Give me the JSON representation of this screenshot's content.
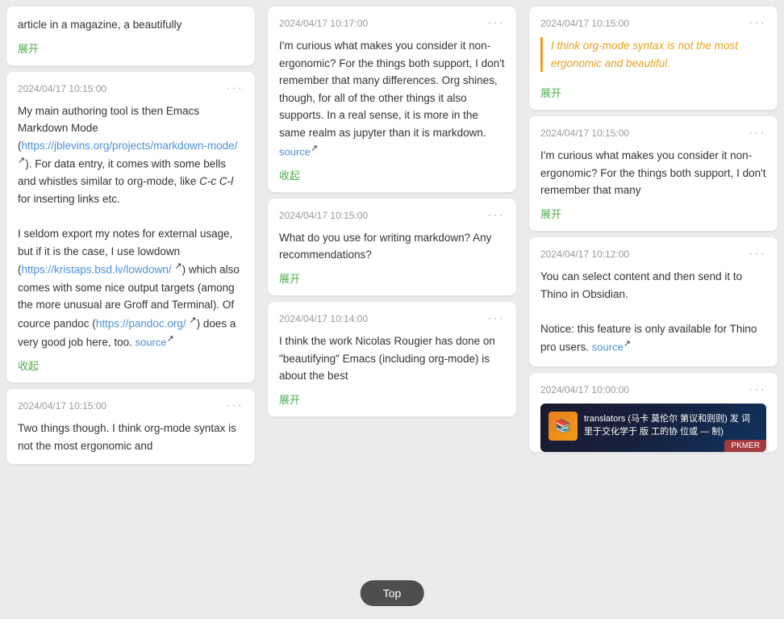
{
  "colors": {
    "accent_green": "#4caf50",
    "accent_blue": "#4a90d9",
    "accent_orange": "#e67e22",
    "text_muted": "#999",
    "bg_card": "#ffffff",
    "bg_page": "#e8e8e8"
  },
  "top_button": "Top",
  "columns": [
    {
      "id": "left",
      "cards": [
        {
          "id": "left-1",
          "timestamp": "",
          "has_timestamp": false,
          "truncated_top": true,
          "body_html": "article in a magazine, a beautifully",
          "action": "展开",
          "action_type": "expand"
        },
        {
          "id": "left-2",
          "timestamp": "2024/04/17 10:15:00",
          "body_parts": [
            "My main authoring tool is then Emacs Markdown Mode (",
            "https://jblevins.org/projects/markdown-mode/",
            "https://jblevins.org/projects/markdown-mode/",
            "). For data entry, it comes with some bells and whistles similar to org-mode, like ",
            "C-c C-l",
            " for inserting links etc."
          ],
          "body_text": "My main authoring tool is then Emacs Markdown Mode (https://jblevins.org/projects/markdown-mode/). For data entry, it comes with some bells and whistles similar to org-mode, like C-c C-l for inserting links etc.",
          "link1_text": "https://jblevins.org/projects/markdown-mode/",
          "link1_url": "https://jblevins.org/projects/markdown-mode/",
          "paragraph2": "I seldom export my notes for external usage, but if it is the case, I use lowdown (https://kristaps.bsd.lv/lowdown/) which also comes with some nice output targets (among the more unusual are Groff and Terminal). Of cource pandoc (https://pandoc.org/) does a very good job here, too.",
          "link2_text": "https://kristaps.bsd.lv/lowdown/",
          "link3_text": "https://pandoc.org/",
          "source_text": "source",
          "action": "收起",
          "action_type": "collapse"
        },
        {
          "id": "left-3",
          "timestamp": "2024/04/17 10:15:00",
          "body_text": "Two things though. I think org-mode syntax is not the most ergonomic and",
          "action": null
        }
      ]
    },
    {
      "id": "middle",
      "cards": [
        {
          "id": "mid-1",
          "timestamp": "2024/04/17 10:17:00",
          "body_text": "I'm curious what makes you consider it non-ergonomic? For the things both support, I don't remember that many differences. Org shines, though, for all of the other things it also supports. In a real sense, it is more in the same realm as jupyter than it is markdown.",
          "source_text": "source",
          "action": "收起",
          "action_type": "collapse"
        },
        {
          "id": "mid-2",
          "timestamp": "2024/04/17 10:15:00",
          "body_text": "What do you use for writing markdown? Any recommendations?",
          "action": "展开",
          "action_type": "expand"
        },
        {
          "id": "mid-3",
          "timestamp": "2024/04/17 10:14:00",
          "body_text": "I think the work Nicolas Rougier has done on \"beautifying\" Emacs (including org-mode) is about the best",
          "action": "展开",
          "action_type": "expand"
        }
      ]
    },
    {
      "id": "right",
      "cards": [
        {
          "id": "right-1",
          "timestamp": "2024/04/17 10:15:00",
          "has_quote": true,
          "quote_text": "I think org-mode syntax is not the most ergonomic and beautiful.",
          "action": "展开",
          "action_type": "expand"
        },
        {
          "id": "right-2",
          "timestamp": "2024/04/17 10:15:00",
          "body_text": "I'm curious what makes you consider it non-ergonomic? For the things both support, I don't remember that many",
          "action": "展开",
          "action_type": "expand"
        },
        {
          "id": "right-3",
          "timestamp": "2024/04/17 10:12:00",
          "body_text_1": "You can select content and then send it to Thino in Obsidian.",
          "body_text_2": "Notice: this feature is only available for Thino pro users.",
          "source_text": "source",
          "action": null
        },
        {
          "id": "right-4",
          "timestamp": "2024/04/17 10:00:00",
          "has_notification": true,
          "notif_text": "translators (马卡 莫伦尔 第议和则则) 发 词里于交化学于 版 工的协 位或 — 制)",
          "action": null
        }
      ]
    }
  ],
  "notification": {
    "text": "translators (马卡 莫伦尔 第议和则则) 发 词里于交化学于 版 工的协 位或 — 制)",
    "icon": "📚"
  }
}
